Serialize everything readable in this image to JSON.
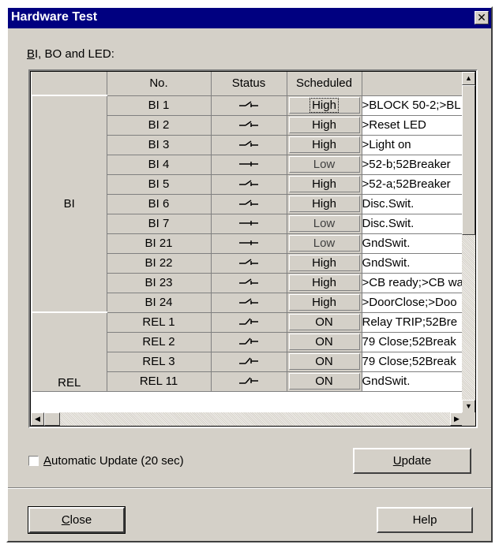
{
  "window": {
    "title": "Hardware Test",
    "close_glyph": "✕"
  },
  "group_label": {
    "accel": "B",
    "rest": "I, BO and LED:"
  },
  "table": {
    "headers": [
      "",
      "No.",
      "Status",
      "Scheduled",
      ""
    ],
    "groups": [
      "BI",
      "REL"
    ],
    "rows": [
      {
        "no": "BI 1",
        "status": "open",
        "scheduled": "High",
        "desc": ">BLOCK 50-2;>BL"
      },
      {
        "no": "BI 2",
        "status": "open",
        "scheduled": "High",
        "desc": ">Reset LED"
      },
      {
        "no": "BI 3",
        "status": "open",
        "scheduled": "High",
        "desc": ">Light on"
      },
      {
        "no": "BI 4",
        "status": "closed",
        "scheduled": "Low",
        "desc": ">52-b;52Breaker"
      },
      {
        "no": "BI 5",
        "status": "open",
        "scheduled": "High",
        "desc": ">52-a;52Breaker"
      },
      {
        "no": "BI 6",
        "status": "open",
        "scheduled": "High",
        "desc": "Disc.Swit."
      },
      {
        "no": "BI 7",
        "status": "closed",
        "scheduled": "Low",
        "desc": "Disc.Swit."
      },
      {
        "no": "BI 21",
        "status": "closed",
        "scheduled": "Low",
        "desc": "GndSwit."
      },
      {
        "no": "BI 22",
        "status": "open",
        "scheduled": "High",
        "desc": "GndSwit."
      },
      {
        "no": "BI 23",
        "status": "open",
        "scheduled": "High",
        "desc": ">CB ready;>CB wa"
      },
      {
        "no": "BI 24",
        "status": "open",
        "scheduled": "High",
        "desc": ">DoorClose;>Doo"
      },
      {
        "no": "REL 1",
        "status": "relay-open",
        "scheduled": "ON",
        "desc": "Relay TRIP;52Bre"
      },
      {
        "no": "REL 2",
        "status": "relay-open",
        "scheduled": "ON",
        "desc": "79 Close;52Break"
      },
      {
        "no": "REL 3",
        "status": "relay-open",
        "scheduled": "ON",
        "desc": "79 Close;52Break"
      },
      {
        "no": "REL 11",
        "status": "relay-open",
        "scheduled": "ON",
        "desc": "GndSwit."
      }
    ]
  },
  "scrollbars": {
    "up": "▲",
    "down": "▼",
    "left": "◀",
    "right": "▶"
  },
  "auto_update": {
    "accel": "A",
    "rest": "utomatic Update (20 sec)",
    "checked": false
  },
  "buttons": {
    "update": {
      "accel": "U",
      "rest": "pdate"
    },
    "close": {
      "accel": "C",
      "rest": "lose"
    },
    "help": "Help"
  }
}
